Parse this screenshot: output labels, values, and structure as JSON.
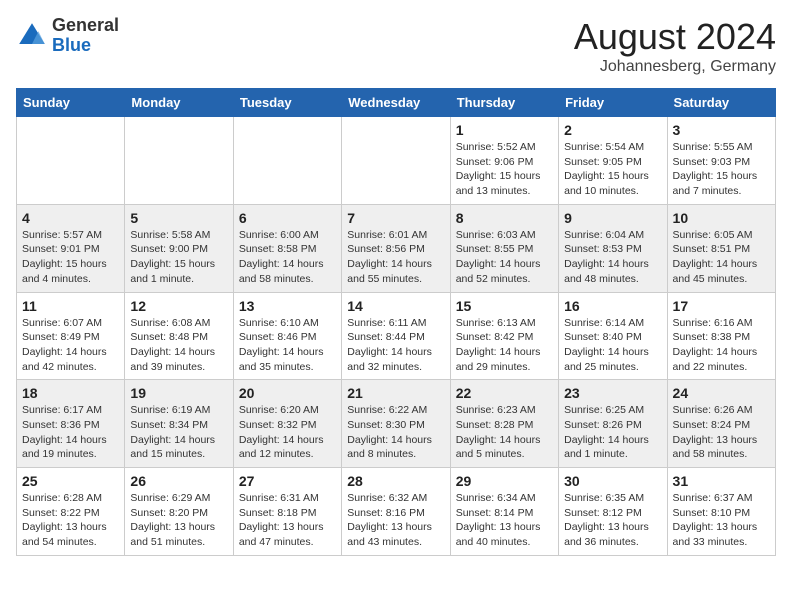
{
  "logo": {
    "general": "General",
    "blue": "Blue"
  },
  "title": {
    "month_year": "August 2024",
    "location": "Johannesberg, Germany"
  },
  "headers": [
    "Sunday",
    "Monday",
    "Tuesday",
    "Wednesday",
    "Thursday",
    "Friday",
    "Saturday"
  ],
  "weeks": [
    [
      {
        "date": "",
        "info": ""
      },
      {
        "date": "",
        "info": ""
      },
      {
        "date": "",
        "info": ""
      },
      {
        "date": "",
        "info": ""
      },
      {
        "date": "1",
        "info": "Sunrise: 5:52 AM\nSunset: 9:06 PM\nDaylight: 15 hours\nand 13 minutes."
      },
      {
        "date": "2",
        "info": "Sunrise: 5:54 AM\nSunset: 9:05 PM\nDaylight: 15 hours\nand 10 minutes."
      },
      {
        "date": "3",
        "info": "Sunrise: 5:55 AM\nSunset: 9:03 PM\nDaylight: 15 hours\nand 7 minutes."
      }
    ],
    [
      {
        "date": "4",
        "info": "Sunrise: 5:57 AM\nSunset: 9:01 PM\nDaylight: 15 hours\nand 4 minutes."
      },
      {
        "date": "5",
        "info": "Sunrise: 5:58 AM\nSunset: 9:00 PM\nDaylight: 15 hours\nand 1 minute."
      },
      {
        "date": "6",
        "info": "Sunrise: 6:00 AM\nSunset: 8:58 PM\nDaylight: 14 hours\nand 58 minutes."
      },
      {
        "date": "7",
        "info": "Sunrise: 6:01 AM\nSunset: 8:56 PM\nDaylight: 14 hours\nand 55 minutes."
      },
      {
        "date": "8",
        "info": "Sunrise: 6:03 AM\nSunset: 8:55 PM\nDaylight: 14 hours\nand 52 minutes."
      },
      {
        "date": "9",
        "info": "Sunrise: 6:04 AM\nSunset: 8:53 PM\nDaylight: 14 hours\nand 48 minutes."
      },
      {
        "date": "10",
        "info": "Sunrise: 6:05 AM\nSunset: 8:51 PM\nDaylight: 14 hours\nand 45 minutes."
      }
    ],
    [
      {
        "date": "11",
        "info": "Sunrise: 6:07 AM\nSunset: 8:49 PM\nDaylight: 14 hours\nand 42 minutes."
      },
      {
        "date": "12",
        "info": "Sunrise: 6:08 AM\nSunset: 8:48 PM\nDaylight: 14 hours\nand 39 minutes."
      },
      {
        "date": "13",
        "info": "Sunrise: 6:10 AM\nSunset: 8:46 PM\nDaylight: 14 hours\nand 35 minutes."
      },
      {
        "date": "14",
        "info": "Sunrise: 6:11 AM\nSunset: 8:44 PM\nDaylight: 14 hours\nand 32 minutes."
      },
      {
        "date": "15",
        "info": "Sunrise: 6:13 AM\nSunset: 8:42 PM\nDaylight: 14 hours\nand 29 minutes."
      },
      {
        "date": "16",
        "info": "Sunrise: 6:14 AM\nSunset: 8:40 PM\nDaylight: 14 hours\nand 25 minutes."
      },
      {
        "date": "17",
        "info": "Sunrise: 6:16 AM\nSunset: 8:38 PM\nDaylight: 14 hours\nand 22 minutes."
      }
    ],
    [
      {
        "date": "18",
        "info": "Sunrise: 6:17 AM\nSunset: 8:36 PM\nDaylight: 14 hours\nand 19 minutes."
      },
      {
        "date": "19",
        "info": "Sunrise: 6:19 AM\nSunset: 8:34 PM\nDaylight: 14 hours\nand 15 minutes."
      },
      {
        "date": "20",
        "info": "Sunrise: 6:20 AM\nSunset: 8:32 PM\nDaylight: 14 hours\nand 12 minutes."
      },
      {
        "date": "21",
        "info": "Sunrise: 6:22 AM\nSunset: 8:30 PM\nDaylight: 14 hours\nand 8 minutes."
      },
      {
        "date": "22",
        "info": "Sunrise: 6:23 AM\nSunset: 8:28 PM\nDaylight: 14 hours\nand 5 minutes."
      },
      {
        "date": "23",
        "info": "Sunrise: 6:25 AM\nSunset: 8:26 PM\nDaylight: 14 hours\nand 1 minute."
      },
      {
        "date": "24",
        "info": "Sunrise: 6:26 AM\nSunset: 8:24 PM\nDaylight: 13 hours\nand 58 minutes."
      }
    ],
    [
      {
        "date": "25",
        "info": "Sunrise: 6:28 AM\nSunset: 8:22 PM\nDaylight: 13 hours\nand 54 minutes."
      },
      {
        "date": "26",
        "info": "Sunrise: 6:29 AM\nSunset: 8:20 PM\nDaylight: 13 hours\nand 51 minutes."
      },
      {
        "date": "27",
        "info": "Sunrise: 6:31 AM\nSunset: 8:18 PM\nDaylight: 13 hours\nand 47 minutes."
      },
      {
        "date": "28",
        "info": "Sunrise: 6:32 AM\nSunset: 8:16 PM\nDaylight: 13 hours\nand 43 minutes."
      },
      {
        "date": "29",
        "info": "Sunrise: 6:34 AM\nSunset: 8:14 PM\nDaylight: 13 hours\nand 40 minutes."
      },
      {
        "date": "30",
        "info": "Sunrise: 6:35 AM\nSunset: 8:12 PM\nDaylight: 13 hours\nand 36 minutes."
      },
      {
        "date": "31",
        "info": "Sunrise: 6:37 AM\nSunset: 8:10 PM\nDaylight: 13 hours\nand 33 minutes."
      }
    ]
  ]
}
